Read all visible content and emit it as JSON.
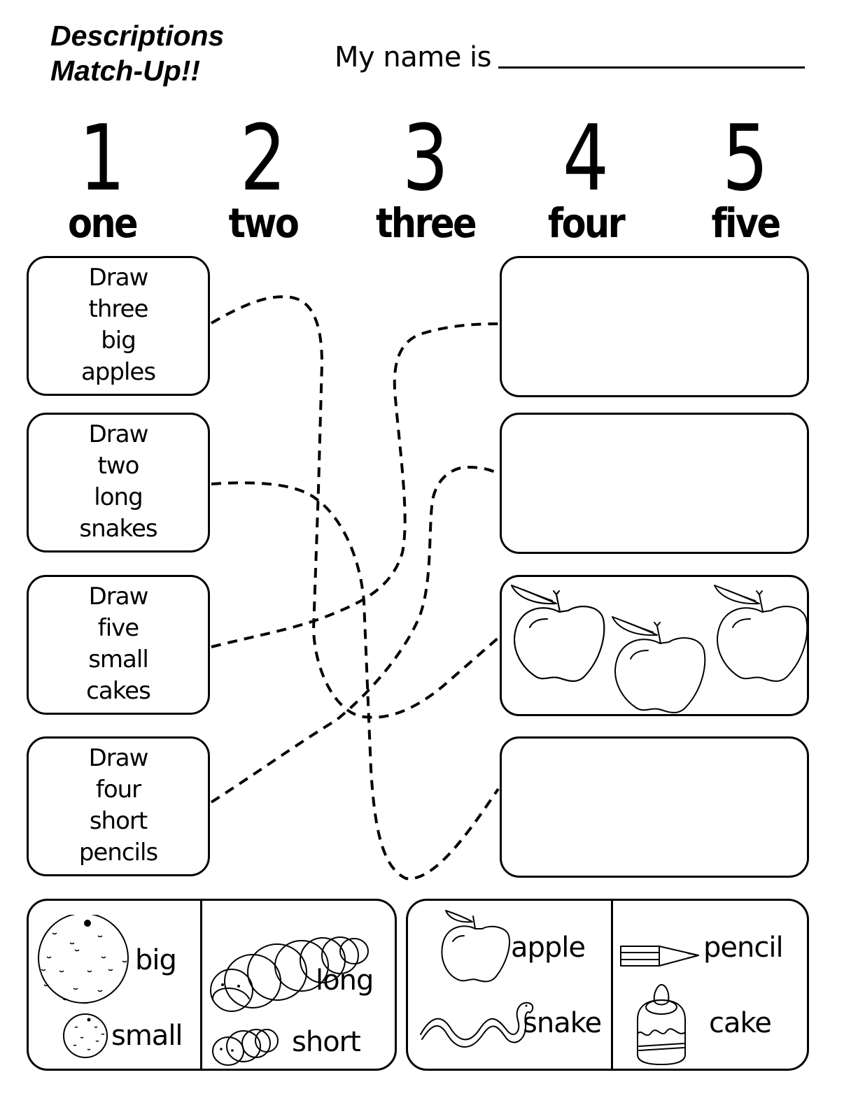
{
  "header": {
    "title_line1": "Descriptions",
    "title_line2": "Match-Up!!",
    "name_label": "My name is",
    "name_field_value": ""
  },
  "numbers": [
    {
      "digit": "1",
      "word": "one"
    },
    {
      "digit": "2",
      "word": "two"
    },
    {
      "digit": "3",
      "word": "three"
    },
    {
      "digit": "4",
      "word": "four"
    },
    {
      "digit": "5",
      "word": "five"
    }
  ],
  "descriptions": [
    {
      "lines": [
        "Draw",
        "three",
        "big",
        "apples"
      ]
    },
    {
      "lines": [
        "Draw",
        "two",
        "long",
        "snakes"
      ]
    },
    {
      "lines": [
        "Draw",
        "five",
        "small",
        "cakes"
      ]
    },
    {
      "lines": [
        "Draw",
        "four",
        "short",
        "pencils"
      ]
    }
  ],
  "picture_boxes": [
    {
      "content": "empty"
    },
    {
      "content": "empty"
    },
    {
      "content": "apples",
      "count": 3
    },
    {
      "content": "empty"
    }
  ],
  "matches": [
    {
      "description": 1,
      "picture_box": 3
    },
    {
      "description": 2,
      "picture_box": 4
    },
    {
      "description": 3,
      "picture_box": 1
    },
    {
      "description": 4,
      "picture_box": 2
    }
  ],
  "legend_adjectives": {
    "big": "big",
    "small": "small",
    "long": "long",
    "short": "short"
  },
  "legend_nouns": {
    "apple": "apple",
    "snake": "snake",
    "pencil": "pencil",
    "cake": "cake"
  }
}
